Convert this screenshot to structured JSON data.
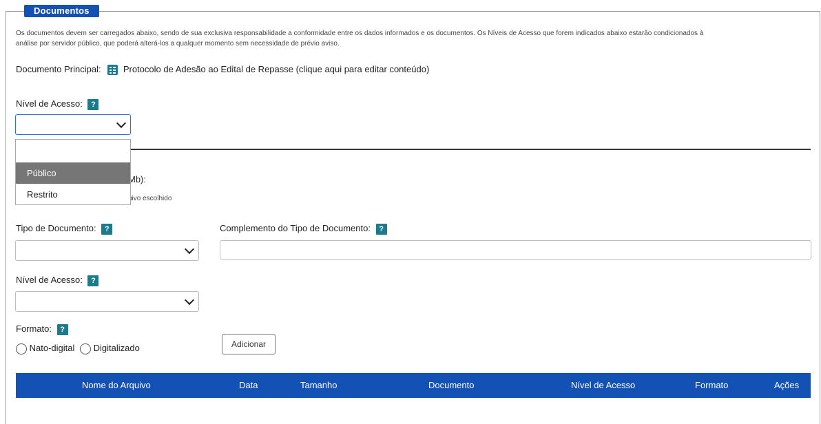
{
  "fieldset": {
    "legend": "Documentos",
    "intro_line1": "Os documentos devem ser carregados abaixo, sendo de sua exclusiva responsabilidade a conformidade entre os dados informados e os documentos. Os Níveis de Acesso que forem indicados abaixo estarão condicionados à",
    "intro_line2": "análise por servidor público, que poderá alterá-los a qualquer momento sem necessidade de prévio aviso."
  },
  "principal": {
    "label": "Documento Principal:",
    "icon": "document-edit-icon",
    "link": "Protocolo de Adesão ao Edital de Repasse (clique aqui para editar conteúdo)"
  },
  "nivel_principal": {
    "label": "Nível de Acesso:",
    "help": "?",
    "value": "",
    "options": [
      "",
      "Público",
      "Restrito"
    ],
    "highlighted": "Público"
  },
  "upload": {
    "label_partial": "Mb):",
    "status_partial": "uivo escolhido"
  },
  "tipo_documento": {
    "label": "Tipo de Documento:",
    "help": "?",
    "value": ""
  },
  "complemento": {
    "label": "Complemento do Tipo de Documento:",
    "help": "?",
    "value": ""
  },
  "nivel_externo": {
    "label": "Nível de Acesso:",
    "help": "?",
    "value": ""
  },
  "formato": {
    "label": "Formato:",
    "help": "?",
    "options": [
      "Nato-digital",
      "Digitalizado"
    ]
  },
  "add_button": "Adicionar",
  "table": {
    "headers": [
      "Nome do Arquivo",
      "Data",
      "Tamanho",
      "Documento",
      "Nível de Acesso",
      "Formato",
      "Ações"
    ]
  },
  "colors": {
    "primary": "#1351b4",
    "help": "#1b7a8c",
    "highlight": "#767676"
  }
}
